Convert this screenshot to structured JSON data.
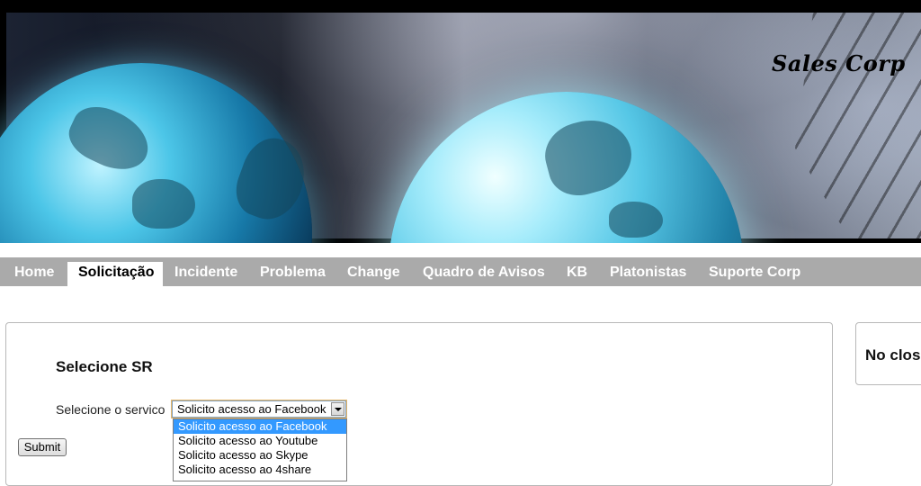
{
  "banner": {
    "brand": "Sales Corp"
  },
  "nav": {
    "items": [
      {
        "label": "Home",
        "active": false
      },
      {
        "label": "Solicitação",
        "active": true
      },
      {
        "label": "Incidente",
        "active": false
      },
      {
        "label": "Problema",
        "active": false
      },
      {
        "label": "Change",
        "active": false
      },
      {
        "label": "Quadro de Avisos",
        "active": false
      },
      {
        "label": "KB",
        "active": false
      },
      {
        "label": "Platonistas",
        "active": false
      },
      {
        "label": "Suporte Corp",
        "active": false
      }
    ]
  },
  "form": {
    "title": "Selecione SR",
    "service_label": "Selecione o servico",
    "selected_value": "Solicito acesso ao Facebook",
    "options": [
      "Solicito acesso ao Facebook",
      "Solicito acesso ao Youtube",
      "Solicito acesso ao Skype",
      "Solicito acesso ao 4share"
    ],
    "submit_label": "Submit"
  },
  "side_panel": {
    "text": "No clos"
  },
  "colors": {
    "nav_bg": "#aaaaaa",
    "selection": "#3399ff"
  }
}
